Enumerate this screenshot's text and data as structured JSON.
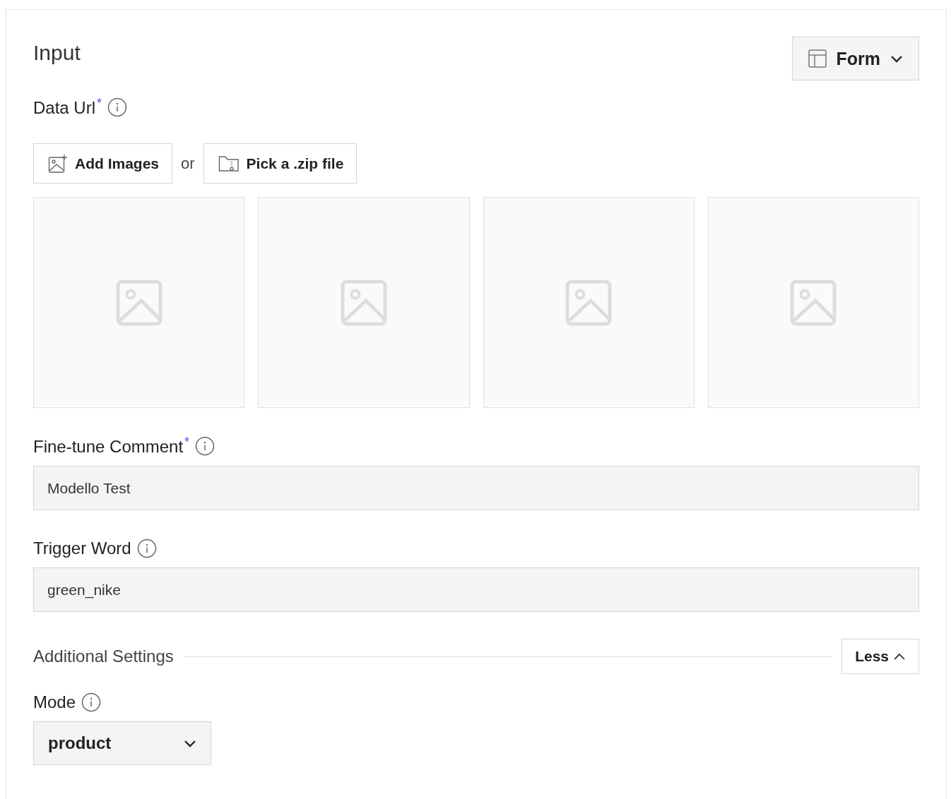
{
  "title": "Input",
  "view_button": {
    "label": "Form"
  },
  "data_url": {
    "label": "Data Url",
    "required_mark": "*",
    "add_button": "Add Images",
    "separator": "or",
    "zip_button": "Pick a .zip file"
  },
  "fields": [
    {
      "label": "Fine-tune Comment",
      "required_mark": "*",
      "value": "Modello Test"
    },
    {
      "label": "Trigger Word",
      "value": "green_nike"
    }
  ],
  "additional_settings": {
    "label": "Additional Settings",
    "toggle": "Less",
    "expanded": true
  },
  "mode": {
    "label": "Mode",
    "value": "product"
  }
}
